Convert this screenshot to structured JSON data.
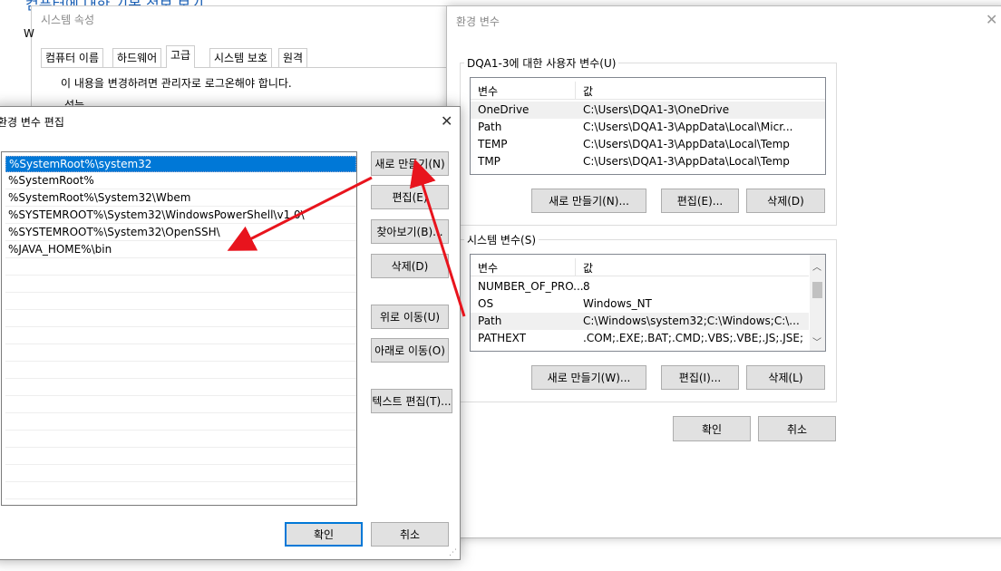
{
  "background_title": "컴퓨터에 대한 기본 정보 보기",
  "system_props": {
    "title": "시스템 속성",
    "tabs": [
      {
        "label": "컴퓨터 이름"
      },
      {
        "label": "하드웨어"
      },
      {
        "label": "고급"
      },
      {
        "label": "시스템 보호"
      },
      {
        "label": "원격"
      }
    ],
    "notice": "이 내용을 변경하려면 관리자로 로그온해야 합니다.",
    "section": "성능",
    "left_fragment": "W"
  },
  "env_vars": {
    "title": "환경 변수",
    "user_group": "DQA1-3에 대한 사용자 변수(U)",
    "col_var": "변수",
    "col_val": "값",
    "user_rows": [
      {
        "name": "OneDrive",
        "value": "C:\\Users\\DQA1-3\\OneDrive"
      },
      {
        "name": "Path",
        "value": "C:\\Users\\DQA1-3\\AppData\\Local\\Micr..."
      },
      {
        "name": "TEMP",
        "value": "C:\\Users\\DQA1-3\\AppData\\Local\\Temp"
      },
      {
        "name": "TMP",
        "value": "C:\\Users\\DQA1-3\\AppData\\Local\\Temp"
      }
    ],
    "user_buttons": {
      "new": "새로 만들기(N)...",
      "edit": "편집(E)...",
      "delete": "삭제(D)"
    },
    "system_group": "시스템 변수(S)",
    "system_rows": [
      {
        "name": "NUMBER_OF_PRO...",
        "value": "8"
      },
      {
        "name": "OS",
        "value": "Windows_NT"
      },
      {
        "name": "Path",
        "value": "C:\\Windows\\system32;C:\\Windows;C:\\..."
      },
      {
        "name": "PATHEXT",
        "value": ".COM;.EXE;.BAT;.CMD;.VBS;.VBE;.JS;.JSE;.W..."
      }
    ],
    "system_buttons": {
      "new": "새로 만들기(W)...",
      "edit": "편집(I)...",
      "delete": "삭제(L)"
    },
    "ok": "확인",
    "cancel": "취소"
  },
  "edit_env": {
    "title": "환경 변수 편집",
    "paths": [
      "%SystemRoot%\\system32",
      "%SystemRoot%",
      "%SystemRoot%\\System32\\Wbem",
      "%SYSTEMROOT%\\System32\\WindowsPowerShell\\v1.0\\",
      "%SYSTEMROOT%\\System32\\OpenSSH\\",
      "%JAVA_HOME%\\bin"
    ],
    "buttons": {
      "new": "새로 만들기(N)",
      "edit": "편집(E)",
      "browse": "찾아보기(B)...",
      "delete": "삭제(D)",
      "up": "위로 이동(U)",
      "down": "아래로 이동(O)",
      "text_edit": "텍스트 편집(T)..."
    },
    "ok": "확인",
    "cancel": "취소"
  },
  "colors": {
    "accent": "#0078d7",
    "arrow": "#e8141d"
  }
}
